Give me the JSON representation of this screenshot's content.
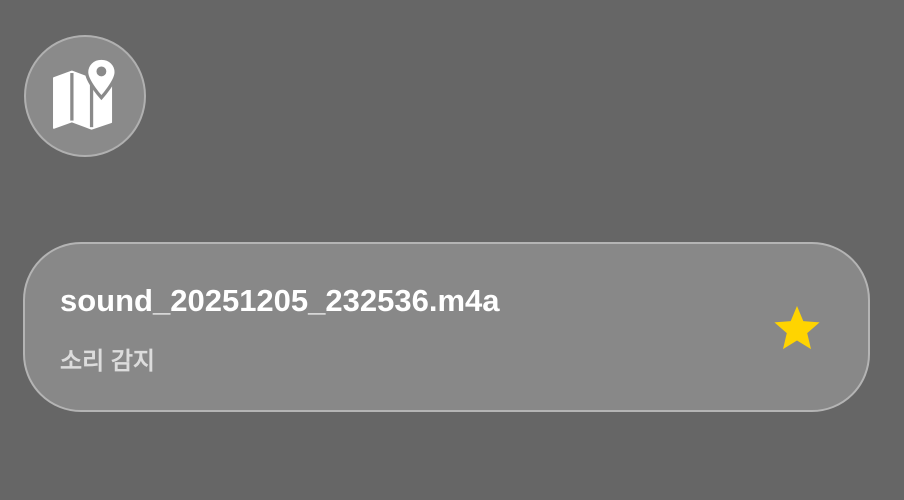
{
  "map_button": {
    "icon": "map-pin-icon"
  },
  "recording": {
    "filename": "sound_20251205_232536.m4a",
    "label": "소리 감지",
    "favorite_icon": "star-icon",
    "favorite_color": "#FFD400"
  }
}
